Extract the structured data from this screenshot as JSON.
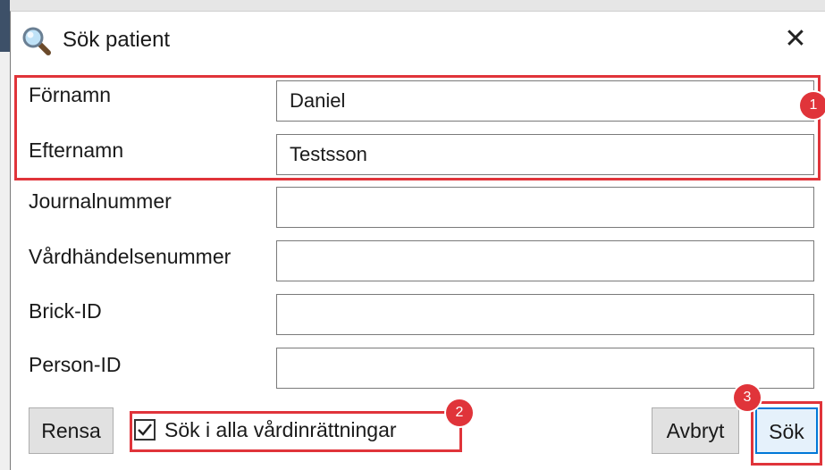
{
  "dialog": {
    "title": "Sök patient",
    "close_glyph": "✕"
  },
  "form": {
    "fields": [
      {
        "label": "Förnamn",
        "value": "Daniel"
      },
      {
        "label": "Efternamn",
        "value": "Testsson"
      },
      {
        "label": "Journalnummer",
        "value": ""
      },
      {
        "label": "Vårdhändelsenummer",
        "value": ""
      },
      {
        "label": "Brick-ID",
        "value": ""
      },
      {
        "label": "Person-ID",
        "value": ""
      }
    ]
  },
  "footer": {
    "clear_label": "Rensa",
    "search_all_label": "Sök i alla vårdinrättningar",
    "search_all_checked": true,
    "cancel_label": "Avbryt",
    "search_label": "Sök"
  },
  "annotations": {
    "markers": [
      "1",
      "2",
      "3"
    ],
    "color": "#e0343a"
  },
  "icons": {
    "title": "magnifier-icon",
    "close": "close-icon",
    "check": "checkmark-icon"
  }
}
